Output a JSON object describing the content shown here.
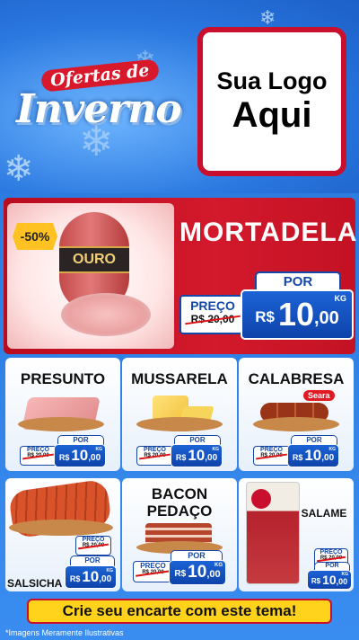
{
  "header": {
    "title_top": "Ofertas de",
    "title_main": "Inverno",
    "logo_line1": "Sua Logo",
    "logo_line2": "Aqui"
  },
  "hero": {
    "discount": "-50%",
    "brand": "OURO",
    "name": "MORTADELA",
    "por": "POR",
    "preco_label": "PREÇO",
    "old_price": "R$ 20,00",
    "currency": "R$",
    "price_int": "10",
    "price_dec": ",00",
    "unit": "KG"
  },
  "products": [
    {
      "name": "PRESUNTO",
      "por": "POR",
      "preco_label": "PREÇO",
      "old_price": "R$ 20,00",
      "currency": "R$",
      "price_int": "10",
      "price_dec": ",00",
      "unit": "KG"
    },
    {
      "name": "MUSSARELA",
      "por": "POR",
      "preco_label": "PREÇO",
      "old_price": "R$ 20,00",
      "currency": "R$",
      "price_int": "10",
      "price_dec": ",00",
      "unit": "KG"
    },
    {
      "name": "CALABRESA",
      "brand": "Seara",
      "por": "POR",
      "preco_label": "PREÇO",
      "old_price": "R$ 20,00",
      "currency": "R$",
      "price_int": "10",
      "price_dec": ",00",
      "unit": "KG"
    },
    {
      "name": "SALSICHA",
      "por": "POR",
      "preco_label": "PREÇO",
      "old_price": "R$ 20,00",
      "currency": "R$",
      "price_int": "10",
      "price_dec": ",00",
      "unit": "KG"
    },
    {
      "name_line1": "BACON",
      "name_line2": "PEDAÇO",
      "por": "POR",
      "preco_label": "PREÇO",
      "old_price": "R$ 20,00",
      "currency": "R$",
      "price_int": "10",
      "price_dec": ",00",
      "unit": "KG"
    },
    {
      "name": "SALAME",
      "por": "POR",
      "preco_label": "PREÇO",
      "old_price": "R$ 20,00",
      "currency": "R$",
      "price_int": "10",
      "price_dec": ",00",
      "unit": "KG"
    }
  ],
  "cta": "Crie seu encarte com este tema!",
  "disclaimer": "*Imagens Meramente Ilustrativas",
  "colors": {
    "brand_red": "#c8102e",
    "brand_blue": "#1447a8",
    "cta_yellow": "#ffd21c",
    "discount_yellow": "#ffc222"
  }
}
